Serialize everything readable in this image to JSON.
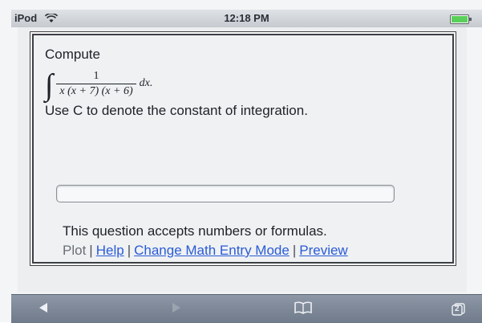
{
  "status_bar": {
    "device": "iPod",
    "time": "12:18 PM"
  },
  "question": {
    "prompt": "Compute",
    "integral": {
      "sign": "∫",
      "numerator": "1",
      "denominator": "x (x + 7) (x + 6)",
      "differential": "dx."
    },
    "instruction": "Use C to denote the constant of integration."
  },
  "answer_field": {
    "value": "",
    "placeholder": ""
  },
  "info": {
    "accepts": "This question accepts numbers or formulas."
  },
  "links": {
    "plot": "Plot",
    "separator": "|",
    "help": "Help",
    "change_mode": "Change Math Entry Mode",
    "preview": "Preview"
  },
  "toolbar": {
    "back_icon": "back-arrow-icon",
    "forward_icon": "forward-arrow-icon",
    "bookmarks_icon": "bookmarks-icon",
    "pages_icon": "pages-icon",
    "pages_count": "2"
  },
  "colors": {
    "link": "#2a5bd6",
    "toolbar": "#7a8596",
    "battery": "#5ad05a"
  }
}
